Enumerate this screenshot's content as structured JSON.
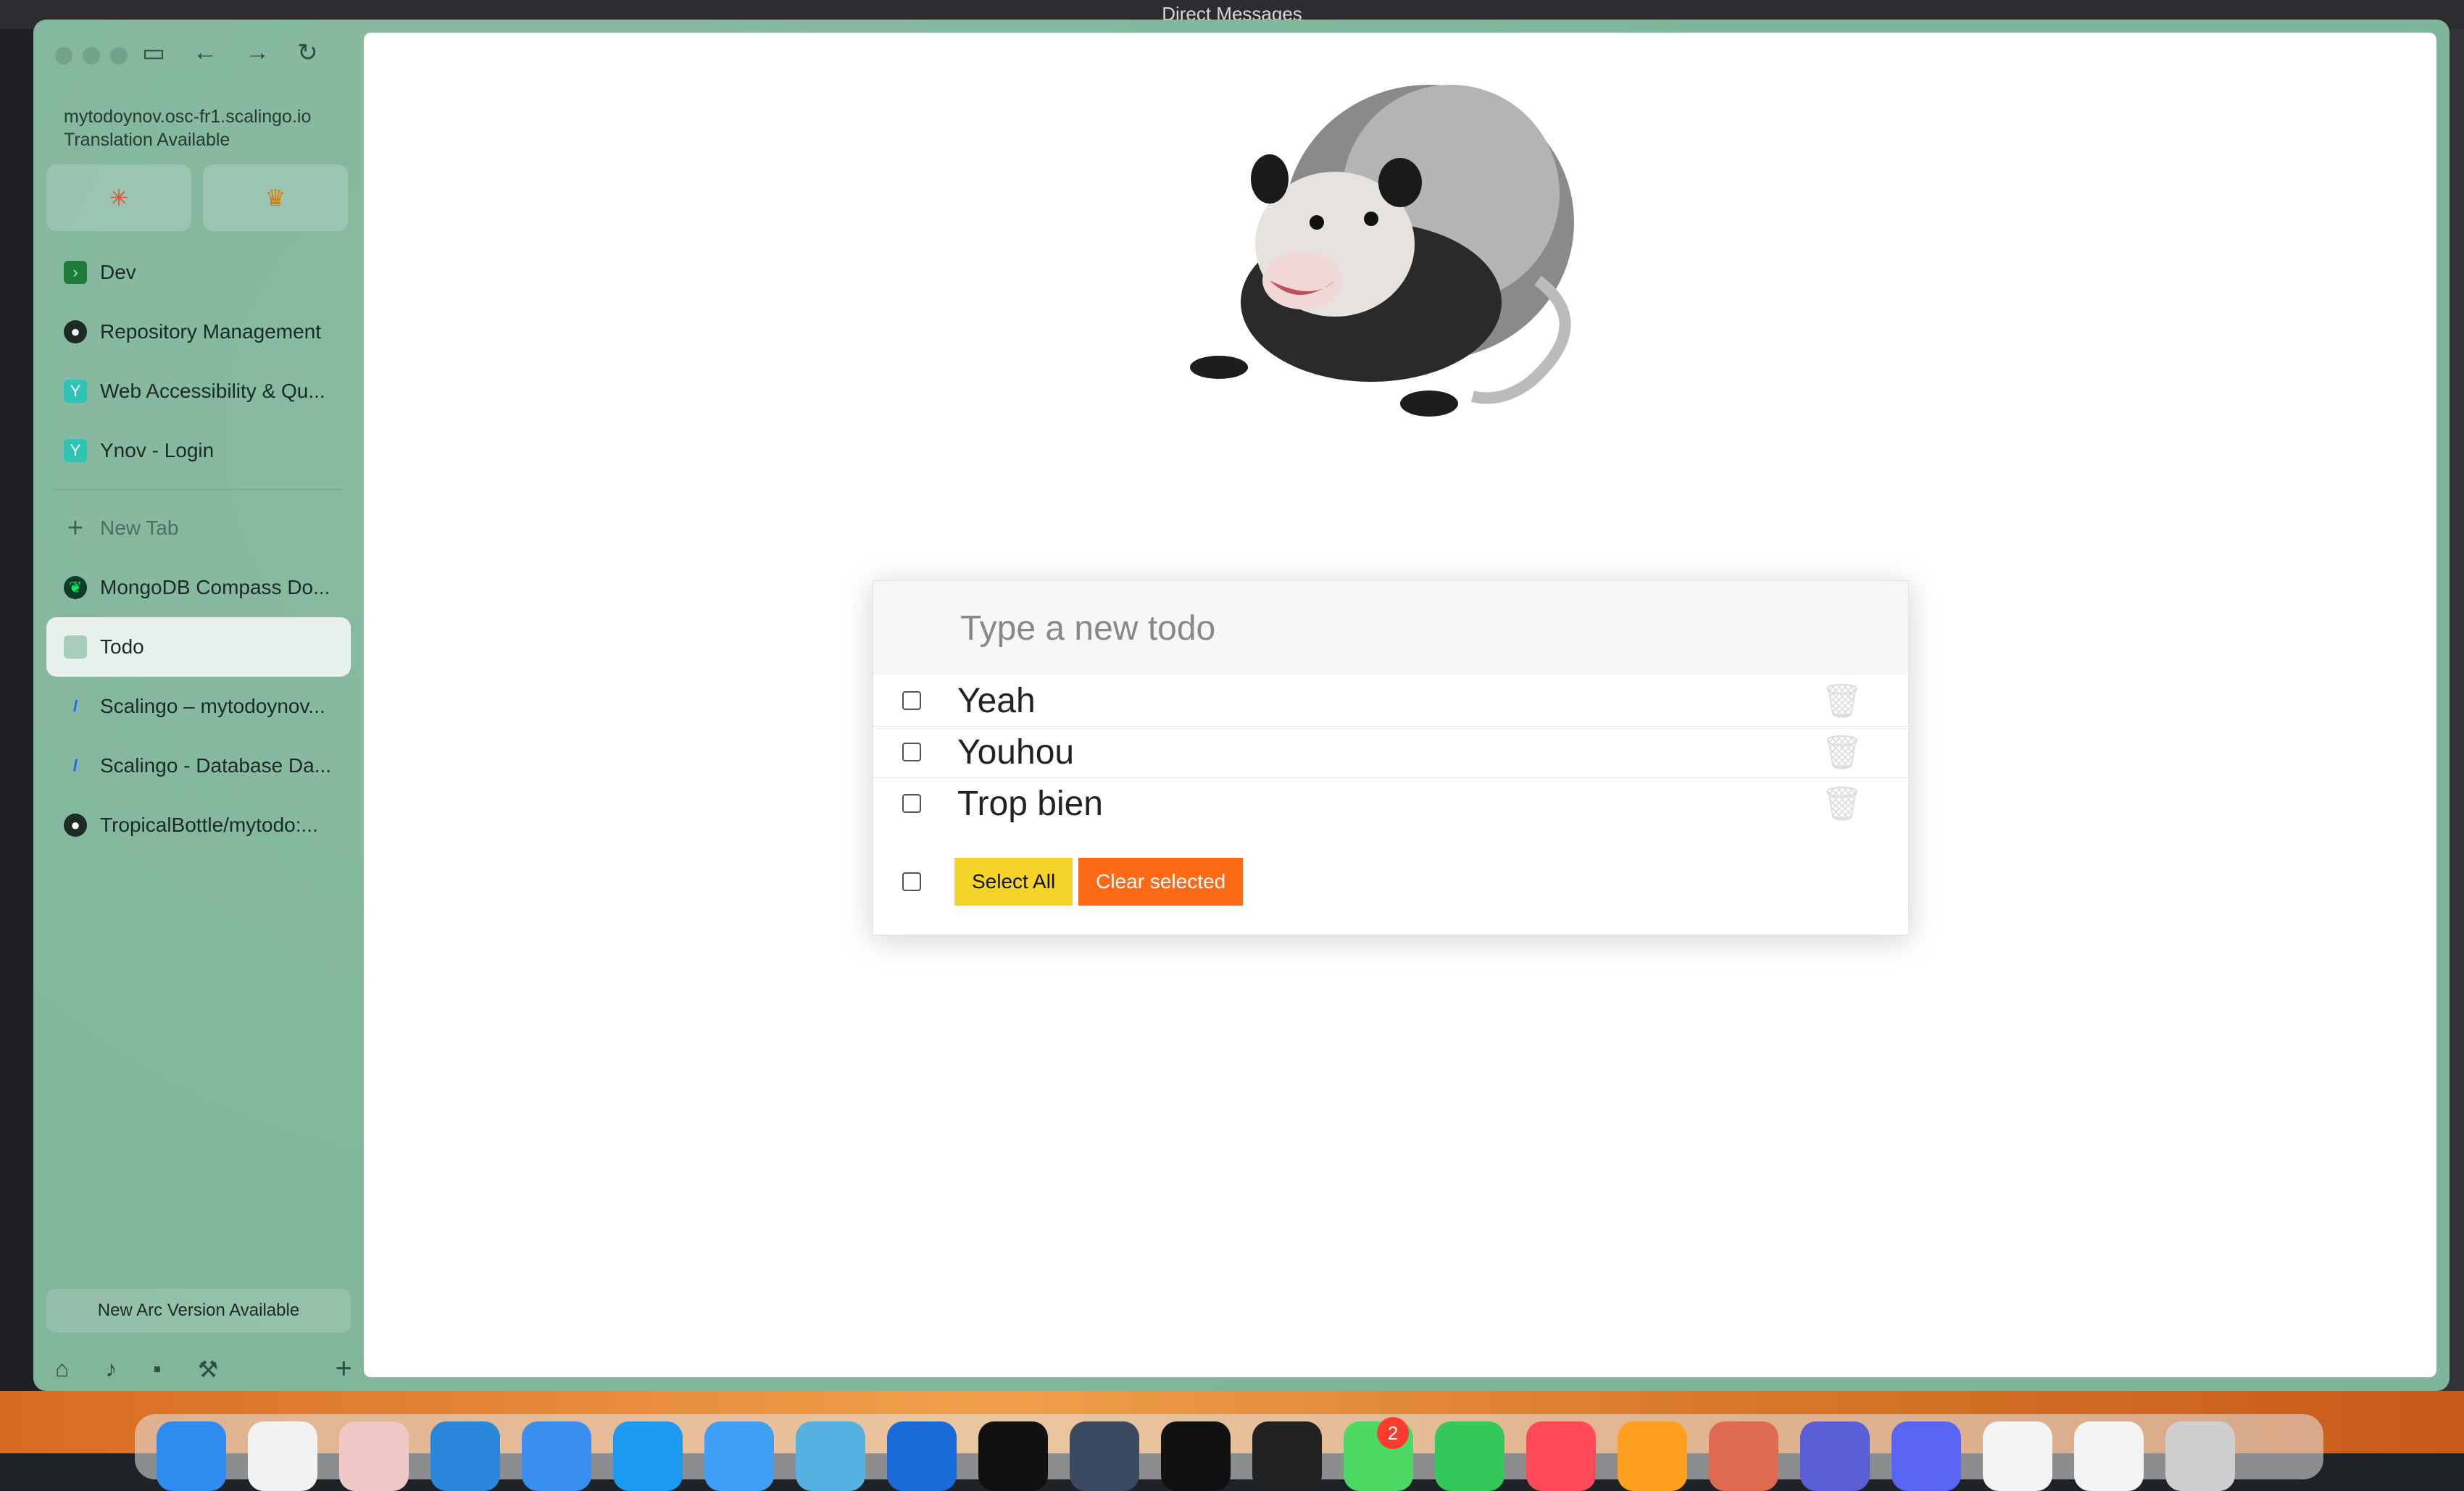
{
  "background_window": {
    "title": "Direct Messages"
  },
  "browser": {
    "url": "mytodoynov.osc-fr1.scalingo.io",
    "translation_note": "Translation Available",
    "tabs": [
      {
        "label": "Dev",
        "icon": "terminal-icon"
      },
      {
        "label": "Repository Management",
        "icon": "github-icon"
      },
      {
        "label": "Web Accessibility & Qu...",
        "icon": "ynov-icon"
      },
      {
        "label": "Ynov - Login",
        "icon": "ynov-icon"
      },
      {
        "label": "New Tab",
        "icon": "plus-icon"
      },
      {
        "label": "MongoDB Compass Do...",
        "icon": "mongodb-icon"
      },
      {
        "label": "Todo",
        "icon": "todo-icon",
        "selected": true
      },
      {
        "label": "Scalingo – mytodoynov...",
        "icon": "scalingo-icon"
      },
      {
        "label": "Scalingo - Database Da...",
        "icon": "scalingo-icon"
      },
      {
        "label": "TropicalBottle/mytodo:...",
        "icon": "github-icon"
      }
    ],
    "update_notice": "New Arc Version Available"
  },
  "todo": {
    "placeholder": "Type a new todo",
    "items": [
      {
        "text": "Yeah",
        "done": false
      },
      {
        "text": "Youhou",
        "done": false
      },
      {
        "text": "Trop bien",
        "done": false
      }
    ],
    "select_all_label": "Select All",
    "clear_selected_label": "Clear selected"
  },
  "dock": {
    "messages_badge": "2"
  },
  "colors": {
    "sidebar": "#7fb59a",
    "select_all": "#f5d328",
    "clear_selected": "#ff6a17"
  }
}
